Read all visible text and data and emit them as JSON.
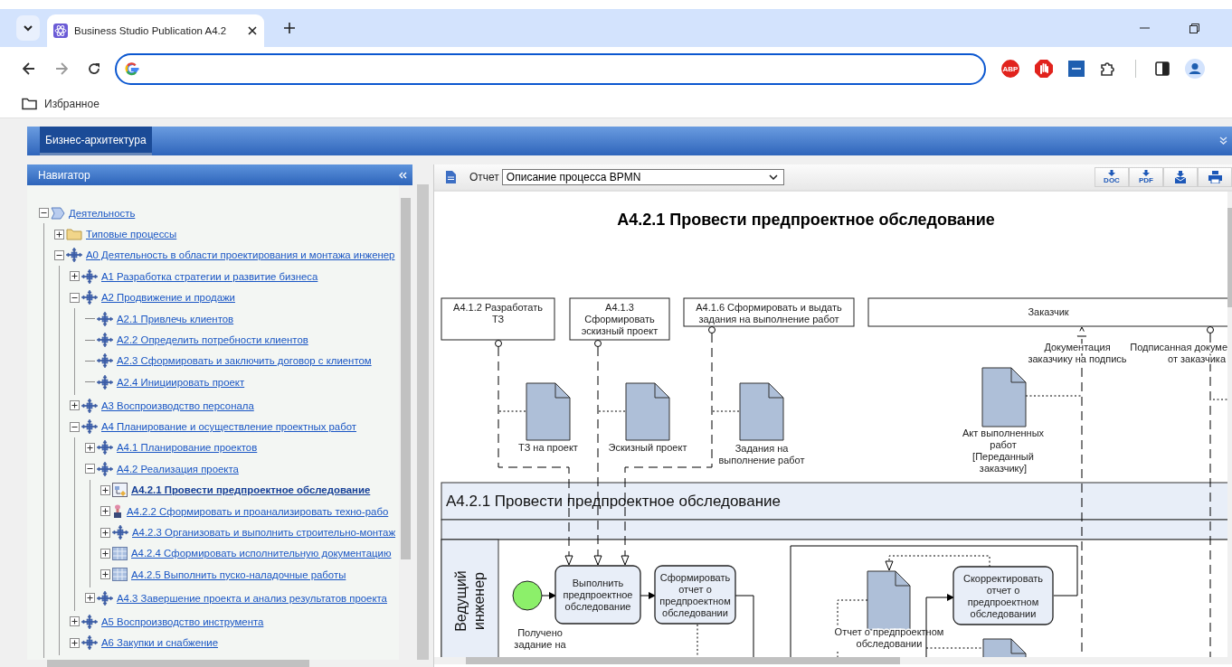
{
  "browser": {
    "tab_title": "Business Studio Publication A4.2",
    "extensions": [
      {
        "kind": "abp",
        "label": "ABP"
      },
      {
        "kind": "stop"
      },
      {
        "kind": "ets"
      },
      {
        "kind": "puzzle"
      },
      {
        "kind": "sidebar"
      },
      {
        "kind": "profile"
      }
    ],
    "bookmarks": [
      {
        "label": "Избранное"
      }
    ]
  },
  "app": {
    "tabs": [
      {
        "label": "Бизнес-архитектура",
        "selected": true
      }
    ]
  },
  "navigator": {
    "title": "Навигатор",
    "tree": [
      {
        "label": "Деятельность",
        "kind": "activity",
        "expanded": true,
        "selected": false,
        "children": [
          {
            "label": "Типовые процессы",
            "kind": "folder",
            "expanded": false,
            "selected": false
          },
          {
            "label": "А0 Деятельность в области проектирования и монтажа инженер",
            "kind": "process",
            "expanded": true,
            "selected": false,
            "children": [
              {
                "label": "А1 Разработка стратегии и развитие бизнеса",
                "kind": "process",
                "expanded": false,
                "selected": false
              },
              {
                "label": "А2 Продвижение и продажи",
                "kind": "process",
                "expanded": true,
                "selected": false,
                "children": [
                  {
                    "label": "А2.1 Привлечь клиентов",
                    "kind": "process",
                    "selected": false
                  },
                  {
                    "label": "А2.2 Определить потребности клиентов",
                    "kind": "process",
                    "selected": false
                  },
                  {
                    "label": "А2.3 Сформировать и заключить договор с клиентом",
                    "kind": "process",
                    "selected": false
                  },
                  {
                    "label": "А2.4 Инициировать проект",
                    "kind": "process",
                    "selected": false
                  }
                ]
              },
              {
                "label": "А3 Воспроизводство персонала",
                "kind": "process",
                "expanded": false,
                "selected": false
              },
              {
                "label": "А4 Планирование и осуществление проектных работ",
                "kind": "process",
                "expanded": true,
                "selected": false,
                "children": [
                  {
                    "label": "А4.1 Планирование проектов",
                    "kind": "process",
                    "expanded": false,
                    "selected": false
                  },
                  {
                    "label": "А4.2 Реализация проекта",
                    "kind": "process",
                    "expanded": true,
                    "selected": false,
                    "children": [
                      {
                        "label": "А4.2.1 Провести предпроектное обследование",
                        "kind": "bpmn",
                        "expanded": false,
                        "selected": true
                      },
                      {
                        "label": "А4.2.2 Сформировать и проанализировать техно-рабо",
                        "kind": "event",
                        "expanded": false,
                        "selected": false
                      },
                      {
                        "label": "А4.2.3 Организовать и выполнить строительно-монтаж",
                        "kind": "process",
                        "expanded": false,
                        "selected": false
                      },
                      {
                        "label": "А4.2.4 Сформировать исполнительную документацию",
                        "kind": "grid",
                        "expanded": false,
                        "selected": false
                      },
                      {
                        "label": "А4.2.5 Выполнить пуско-наладочные работы",
                        "kind": "grid",
                        "expanded": false,
                        "selected": false
                      }
                    ]
                  },
                  {
                    "label": "А4.3 Завершение проекта и анализ результатов проекта",
                    "kind": "process",
                    "expanded": false,
                    "selected": false
                  }
                ]
              },
              {
                "label": "А5 Воспроизводство инструмента",
                "kind": "process",
                "expanded": false,
                "selected": false
              },
              {
                "label": "А6 Закупки и снабжение",
                "kind": "process",
                "expanded": false,
                "selected": false
              }
            ]
          }
        ]
      }
    ]
  },
  "report": {
    "label": "Отчет",
    "selected_report": "Описание процесса BPMN",
    "exports": [
      {
        "kind": "doc",
        "label": "DOC"
      },
      {
        "kind": "pdf",
        "label": "PDF"
      },
      {
        "kind": "mail"
      },
      {
        "kind": "print"
      }
    ]
  },
  "diagram": {
    "title": "А4.2.1 Провести предпроектное обследование",
    "participants": [
      {
        "lines": [
          "А4.1.2 Разработать",
          "ТЗ"
        ]
      },
      {
        "lines": [
          "А4.1.3",
          "Сформировать",
          "эскизный проект"
        ]
      },
      {
        "lines": [
          "А4.1.6 Сформировать и выдать",
          "задания на выполнение работ"
        ]
      },
      {
        "lines": [
          "Заказчик"
        ]
      }
    ],
    "messages": [
      {
        "lines": [
          "Документация",
          "заказчику на подпись"
        ]
      },
      {
        "lines": [
          "Подписанная докуме",
          "от заказчика"
        ]
      }
    ],
    "data_objects": [
      {
        "lines": [
          "ТЗ на проект"
        ]
      },
      {
        "lines": [
          "Эскизный проект"
        ]
      },
      {
        "lines": [
          "Задания на",
          "выполнение работ"
        ]
      },
      {
        "lines": [
          "Акт выполненных",
          "работ",
          "[Переданный",
          "заказчику]"
        ]
      },
      {
        "lines": [
          "Отчет о предпроектном",
          "обследовании"
        ]
      }
    ],
    "pool": {
      "title": "А4.2.1 Провести предпроектное обследование"
    },
    "lane": {
      "lines": [
        "Ведущий",
        "инженер"
      ]
    },
    "start_event": {
      "lines": [
        "Получено",
        "задание на"
      ]
    },
    "tasks": [
      {
        "lines": [
          "Выполнить",
          "предпроектное",
          "обследование"
        ]
      },
      {
        "lines": [
          "Сформировать",
          "отчет о",
          "предпроектном",
          "обследовании"
        ]
      },
      {
        "lines": [
          "Скорректировать",
          "отчет о",
          "предпроектном",
          "обследовании"
        ]
      }
    ]
  }
}
